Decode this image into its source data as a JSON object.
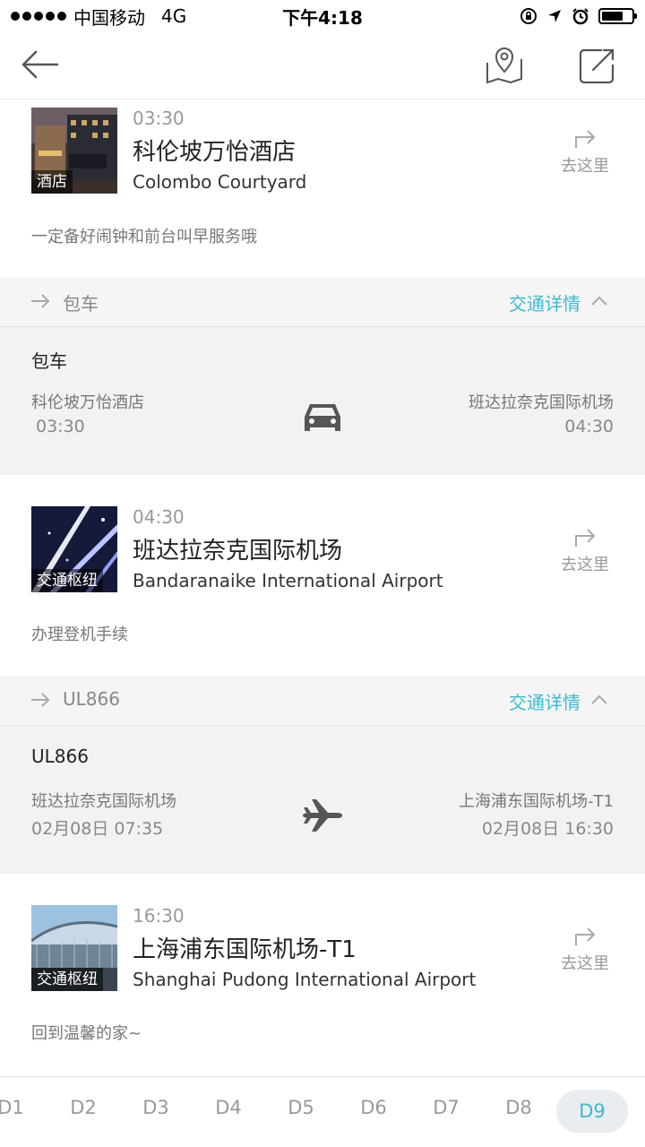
{
  "status_bar": {
    "carrier": "中国移动",
    "network": "4G",
    "time": "下午4:18"
  },
  "nav": {
    "back_icon": "arrow-left-icon",
    "map_icon": "map-pin-icon",
    "share_icon": "share-icon"
  },
  "items": [
    {
      "time": "03:30",
      "name": "科伦坡万怡酒店",
      "name_en": "Colombo Courtyard",
      "tag": "酒店",
      "go_label": "去这里",
      "note": "一定备好闹钟和前台叫早服务哦"
    },
    {
      "time": "04:30",
      "name": "班达拉奈克国际机场",
      "name_en": "Bandaranaike International Airport",
      "tag": "交通枢纽",
      "go_label": "去这里",
      "note": "办理登机手续"
    },
    {
      "time": "16:30",
      "name": "上海浦东国际机场-T1",
      "name_en": "Shanghai Pudong International Airport",
      "tag": "交通枢纽",
      "go_label": "去这里",
      "note": "回到温馨的家~"
    }
  ],
  "transits": [
    {
      "label": "包车",
      "detail": "交通详情",
      "title": "包车",
      "from_name": "科伦坡万怡酒店",
      "from_time": "03:30",
      "to_name": "班达拉奈克国际机场",
      "to_time": "04:30",
      "mode_icon": "car-icon"
    },
    {
      "label": "UL866",
      "detail": "交通详情",
      "title": "UL866",
      "from_name": "班达拉奈克国际机场",
      "from_time": "02月08日 07:35",
      "to_name": "上海浦东国际机场-T1",
      "to_time": "02月08日 16:30",
      "mode_icon": "airplane-icon"
    }
  ],
  "days": [
    "D1",
    "D2",
    "D3",
    "D4",
    "D5",
    "D6",
    "D7",
    "D8",
    "D9"
  ],
  "active_day": "D9",
  "colors": {
    "accent": "#3cb9d1",
    "section_bg": "#f2f2f2"
  }
}
